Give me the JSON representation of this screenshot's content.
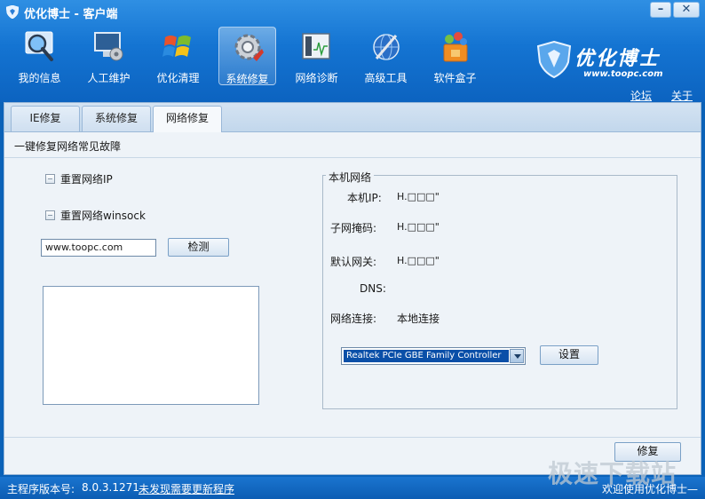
{
  "window": {
    "title": "优化博士 - 客户端",
    "min": "–",
    "close": "✕"
  },
  "toolbar": [
    {
      "label": "我的信息",
      "icon": "magnifier-icon"
    },
    {
      "label": "人工维护",
      "icon": "monitor-tool-icon"
    },
    {
      "label": "优化清理",
      "icon": "windows-flag-icon"
    },
    {
      "label": "系统修复",
      "icon": "gear-icon"
    },
    {
      "label": "网络诊断",
      "icon": "network-icon"
    },
    {
      "label": "高级工具",
      "icon": "globe-tool-icon"
    },
    {
      "label": "软件盒子",
      "icon": "software-box-icon"
    }
  ],
  "brand": {
    "name": "优化博士",
    "url": "www.toopc.com"
  },
  "links": {
    "forum": "论坛",
    "about": "关于"
  },
  "tabs": [
    "IE修复",
    "系统修复",
    "网络修复"
  ],
  "active_tab": "网络修复",
  "section_title": "一键修复网络常见故障",
  "options": {
    "reset_ip": "重置网络IP",
    "reset_winsock": "重置网络winsock"
  },
  "check": {
    "url_value": "www.toopc.com",
    "button": "检测"
  },
  "network": {
    "group_title": "本机网络",
    "ip_label": "本机IP:",
    "ip_value": "H.□□□\"",
    "mask_label": "子网掩码:",
    "mask_value": "H.□□□\"",
    "gateway_label": "默认网关:",
    "gateway_value": "H.□□□\"",
    "dns_label": "DNS:",
    "conn_label": "网络连接:",
    "conn_value": "本地连接",
    "adapter": "Realtek PCIe GBE Family Controller",
    "settings_button": "设置"
  },
  "repair_button": "修复",
  "status": {
    "version_label": "主程序版本号:",
    "version": "8.0.3.1271",
    "update": "未发现需要更新程序",
    "welcome": "欢迎使用优化博士—"
  },
  "watermark": "极速下载站",
  "colors": {
    "banner": "#1474d2",
    "panel": "#eef3f8",
    "selection": "#0a4fa8"
  }
}
